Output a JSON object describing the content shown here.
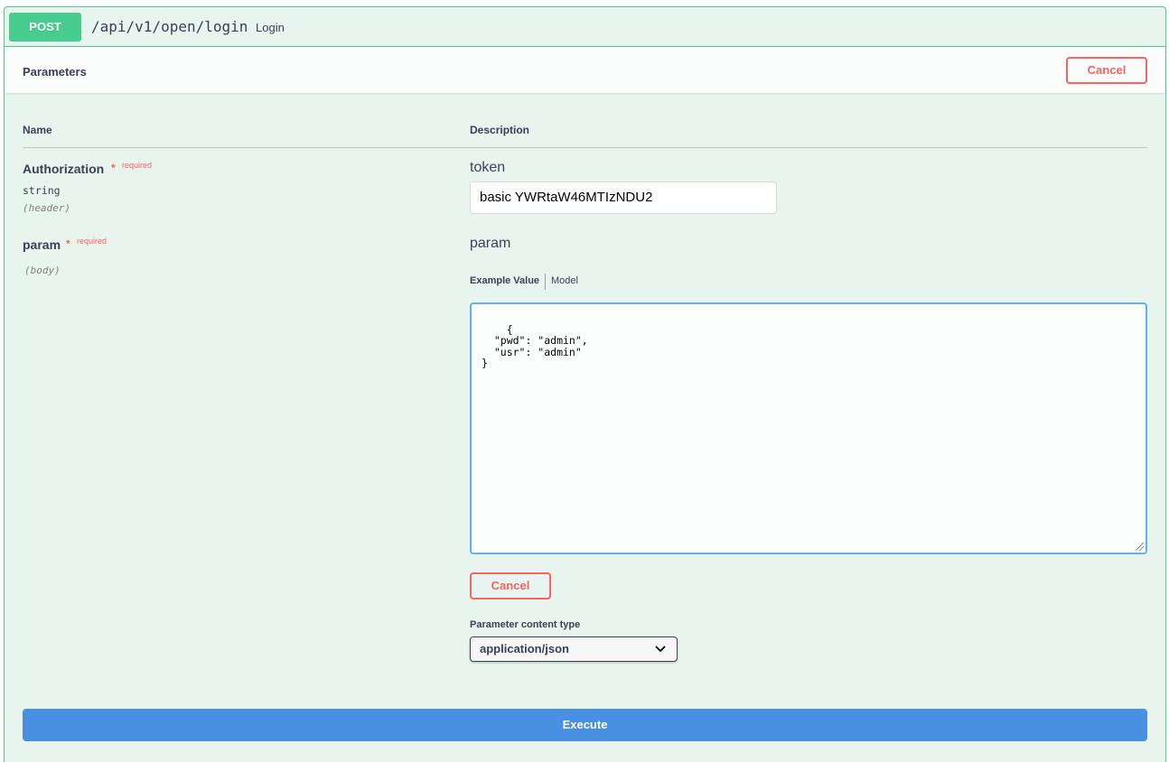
{
  "operation": {
    "method": "POST",
    "path": "/api/v1/open/login",
    "summary": "Login",
    "color": "#49cc90"
  },
  "parameters_section": {
    "title": "Parameters",
    "cancel_label": "Cancel"
  },
  "table": {
    "name_header": "Name",
    "description_header": "Description"
  },
  "params": [
    {
      "name": "Authorization",
      "star": "*",
      "required_label": "required",
      "type": "string",
      "in": "(header)",
      "description": "token",
      "value": "basic YWRtaW46MTIzNDU2"
    },
    {
      "name": "param",
      "star": "*",
      "required_label": "required",
      "in": "(body)",
      "description": "param",
      "tabs": {
        "example": "Example Value",
        "model": "Model"
      },
      "body_value": "{\n  \"pwd\": \"admin\",\n  \"usr\": \"admin\"\n}",
      "cancel_label": "Cancel",
      "content_type_label": "Parameter content type",
      "content_type_selected": "application/json"
    }
  ],
  "execute_label": "Execute",
  "colors": {
    "cancel": "#ff6060",
    "execute": "#4990e2",
    "editor_border": "#61affe"
  },
  "icons": {
    "select_chevron": "chevron-down-icon",
    "resize": "resize-grip-icon"
  }
}
